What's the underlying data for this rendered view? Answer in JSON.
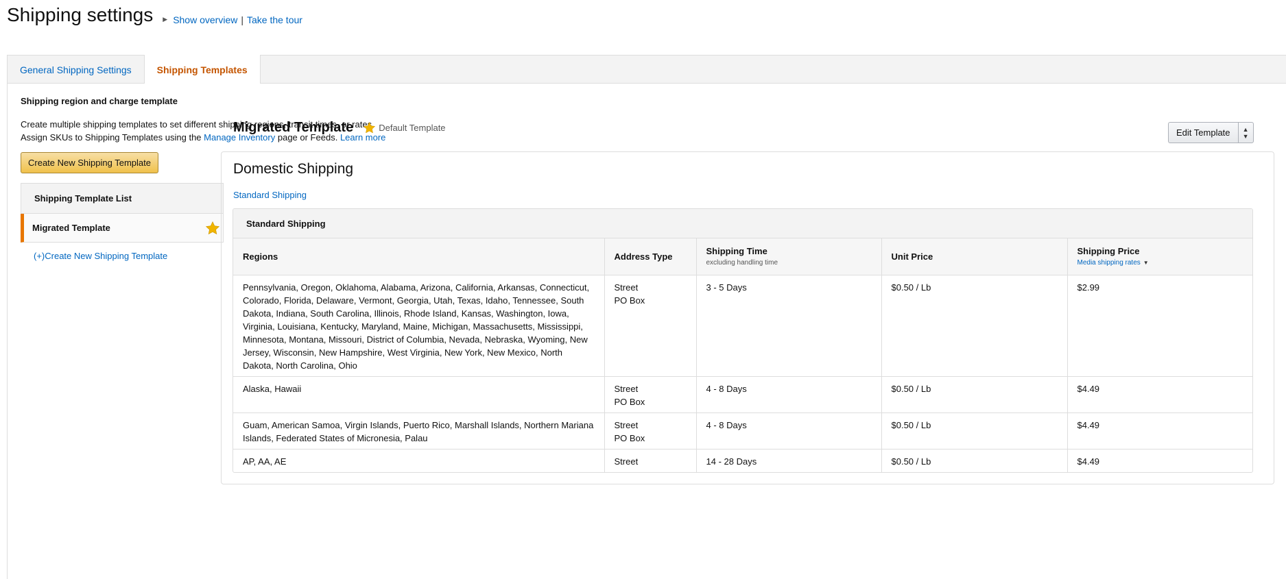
{
  "header": {
    "title": "Shipping settings",
    "show_overview": "Show overview",
    "separator": "|",
    "take_tour": "Take the tour"
  },
  "tabs": [
    {
      "label": "General Shipping Settings",
      "active": false
    },
    {
      "label": "Shipping Templates",
      "active": true
    }
  ],
  "intro": {
    "heading": "Shipping region and charge template",
    "line1": "Create multiple shipping templates to set different shipping regions, transit times, or rates.",
    "line2_prefix": "Assign SKUs to Shipping Templates using the",
    "manage_inventory": "Manage Inventory",
    "line2_suffix": "page or Feeds.",
    "learn_more": "Learn more",
    "create_button": "Create New Shipping Template"
  },
  "sidebar": {
    "header": "Shipping Template List",
    "items": [
      {
        "label": "Migrated Template",
        "default": true
      }
    ],
    "create_link": "(+)Create New Shipping Template"
  },
  "template": {
    "title": "Migrated Template",
    "default_label": "Default Template",
    "edit_button": "Edit Template",
    "section_title": "Domestic Shipping",
    "standard_link": "Standard Shipping",
    "table_caption": "Standard Shipping",
    "columns": {
      "regions": "Regions",
      "address_type": "Address Type",
      "shipping_time": "Shipping Time",
      "shipping_time_sub": "excluding handling time",
      "unit_price": "Unit Price",
      "shipping_price": "Shipping Price",
      "shipping_price_sub": "Media shipping rates"
    },
    "rows": [
      {
        "regions": "Pennsylvania, Oregon, Oklahoma, Alabama, Arizona, California, Arkansas, Connecticut, Colorado, Florida, Delaware, Vermont, Georgia, Utah, Texas, Idaho, Tennessee, South Dakota, Indiana, South Carolina, Illinois, Rhode Island, Kansas, Washington, Iowa, Virginia, Louisiana, Kentucky, Maryland, Maine, Michigan, Massachusetts, Mississippi, Minnesota, Montana, Missouri, District of Columbia, Nevada, Nebraska, Wyoming, New Jersey, Wisconsin, New Hampshire, West Virginia, New York, New Mexico, North Dakota, North Carolina, Ohio",
        "address1": "Street",
        "address2": "PO Box",
        "time": "3 - 5 Days",
        "unit_price": "$0.50 / Lb",
        "shipping_price": "$2.99"
      },
      {
        "regions": "Alaska, Hawaii",
        "address1": "Street",
        "address2": "PO Box",
        "time": "4 - 8 Days",
        "unit_price": "$0.50 / Lb",
        "shipping_price": "$4.49"
      },
      {
        "regions": "Guam, American Samoa, Virgin Islands, Puerto Rico, Marshall Islands, Northern Mariana Islands, Federated States of Micronesia, Palau",
        "address1": "Street",
        "address2": "PO Box",
        "time": "4 - 8 Days",
        "unit_price": "$0.50 / Lb",
        "shipping_price": "$4.49"
      },
      {
        "regions": "AP, AA, AE",
        "address1": "Street",
        "address2": "",
        "time": "14 - 28 Days",
        "unit_price": "$0.50 / Lb",
        "shipping_price": "$4.49"
      }
    ]
  },
  "colors": {
    "link": "#0066c0",
    "active_tab": "#c45500",
    "accent_bar": "#e77600",
    "star": "#f0b400",
    "button_yellow": "#f0c14b"
  },
  "icons": {
    "triangle": "triangle-right-icon",
    "star": "star-icon",
    "caret": "caret-down-icon",
    "updown": "updown-arrow-icon"
  }
}
